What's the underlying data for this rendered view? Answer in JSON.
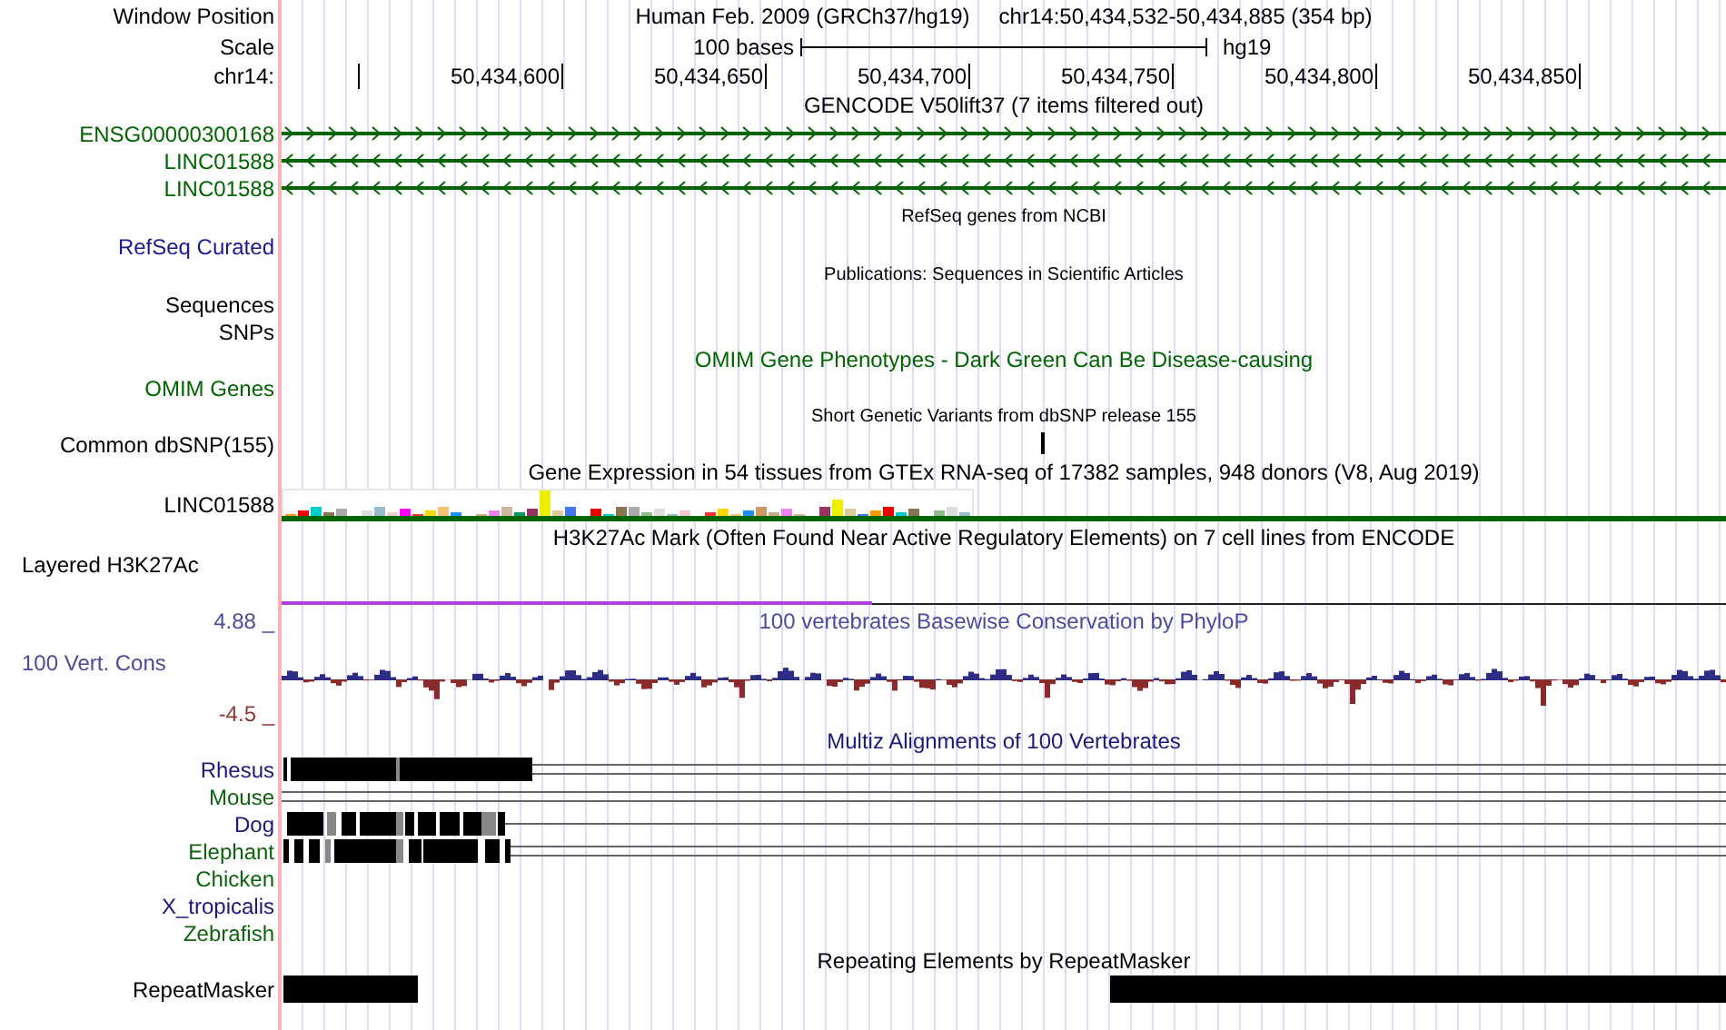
{
  "header": {
    "label": "Window Position",
    "title": "Human Feb. 2009 (GRCh37/hg19)",
    "position": "chr14:50,434,532-50,434,885 (354 bp)"
  },
  "scale": {
    "label": "Scale",
    "bar_label": "100 bases",
    "assembly": "hg19"
  },
  "ruler": {
    "label": "chr14:",
    "ticks": [
      "50,434,600",
      "50,434,650",
      "50,434,700",
      "50,434,750",
      "50,434,800",
      "50,434,850"
    ]
  },
  "tracks": [
    {
      "kind": "genes",
      "title": {
        "text": "GENCODE V50lift37 (7 items filtered out)",
        "color": "#000000",
        "small": false
      },
      "items": [
        {
          "name": "ENSG00000300168",
          "kind": "forward",
          "color": "#006400"
        },
        {
          "name": "LINC01588",
          "kind": "reverse",
          "color": "#006400"
        },
        {
          "name": "LINC01588",
          "kind": "reverse",
          "color": "#006400"
        }
      ]
    },
    {
      "kind": "empty",
      "title": {
        "text": "RefSeq genes from NCBI",
        "color": "#000000",
        "small": true
      },
      "labels": [
        {
          "text": "RefSeq Curated",
          "color": "#1a1a8c"
        }
      ]
    },
    {
      "kind": "empty",
      "title": {
        "text": "Publications: Sequences in Scientific Articles",
        "color": "#000000",
        "small": true
      },
      "labels": [
        {
          "text": "Sequences",
          "color": "#000000"
        },
        {
          "text": "SNPs",
          "color": "#000000"
        }
      ]
    },
    {
      "kind": "empty",
      "title": {
        "text": "OMIM Gene Phenotypes - Dark Green Can Be Disease-causing",
        "color": "#006400",
        "small": false
      },
      "labels": [
        {
          "text": "OMIM Genes",
          "color": "#006400"
        }
      ]
    },
    {
      "kind": "snp",
      "title": {
        "text": "Short Genetic Variants from dbSNP release 155",
        "color": "#000000",
        "small": true
      },
      "labels": [
        {
          "text": "Common dbSNP(155)",
          "color": "#000000"
        }
      ]
    },
    {
      "kind": "expression",
      "title": {
        "text": "Gene Expression in 54 tissues from GTEx RNA-seq of 17382 samples, 948 donors (V8, Aug 2019)",
        "color": "#000000",
        "small": false
      },
      "labels": [
        {
          "text": "LINC01588",
          "color": "#000000"
        }
      ]
    },
    {
      "kind": "signal",
      "title": {
        "text": "H3K27Ac Mark (Often Found Near Active Regulatory Elements) on 7 cell lines from ENCODE",
        "color": "#000000",
        "small": false
      },
      "labels": [
        {
          "text": "Layered H3K27Ac",
          "color": "#000000"
        }
      ]
    },
    {
      "kind": "conservation",
      "title": {
        "text": "100 vertebrates Basewise Conservation by PhyloP",
        "color": "#4b4b9c",
        "small": false
      },
      "labels": [
        {
          "text": "4.88 _",
          "color": "#4b4b9c"
        },
        {
          "text": "100 Vert. Cons",
          "color": "#4b4b9c"
        },
        {
          "text": "-4.5 _",
          "color": "#8b3a3a"
        }
      ]
    },
    {
      "kind": "multiz",
      "title": {
        "text": "Multiz Alignments of 100 Vertebrates",
        "color": "#1a1a7a",
        "small": false
      },
      "species": [
        {
          "name": "Rhesus",
          "color": "#1a1a7a",
          "kind": "double"
        },
        {
          "name": "Mouse",
          "color": "#106410",
          "kind": "double"
        },
        {
          "name": "Dog",
          "color": "#1a1a7a",
          "kind": "single"
        },
        {
          "name": "Elephant",
          "color": "#106410",
          "kind": "double"
        },
        {
          "name": "Chicken",
          "color": "#106410",
          "kind": "none"
        },
        {
          "name": "X_tropicalis",
          "color": "#1a1a7a",
          "kind": "none"
        },
        {
          "name": "Zebrafish",
          "color": "#106410",
          "kind": "none"
        }
      ]
    },
    {
      "kind": "repeats",
      "title": {
        "text": "Repeating Elements by RepeatMasker",
        "color": "#000000",
        "small": false
      },
      "labels": [
        {
          "text": "RepeatMasker",
          "color": "#000000"
        }
      ]
    }
  ]
}
